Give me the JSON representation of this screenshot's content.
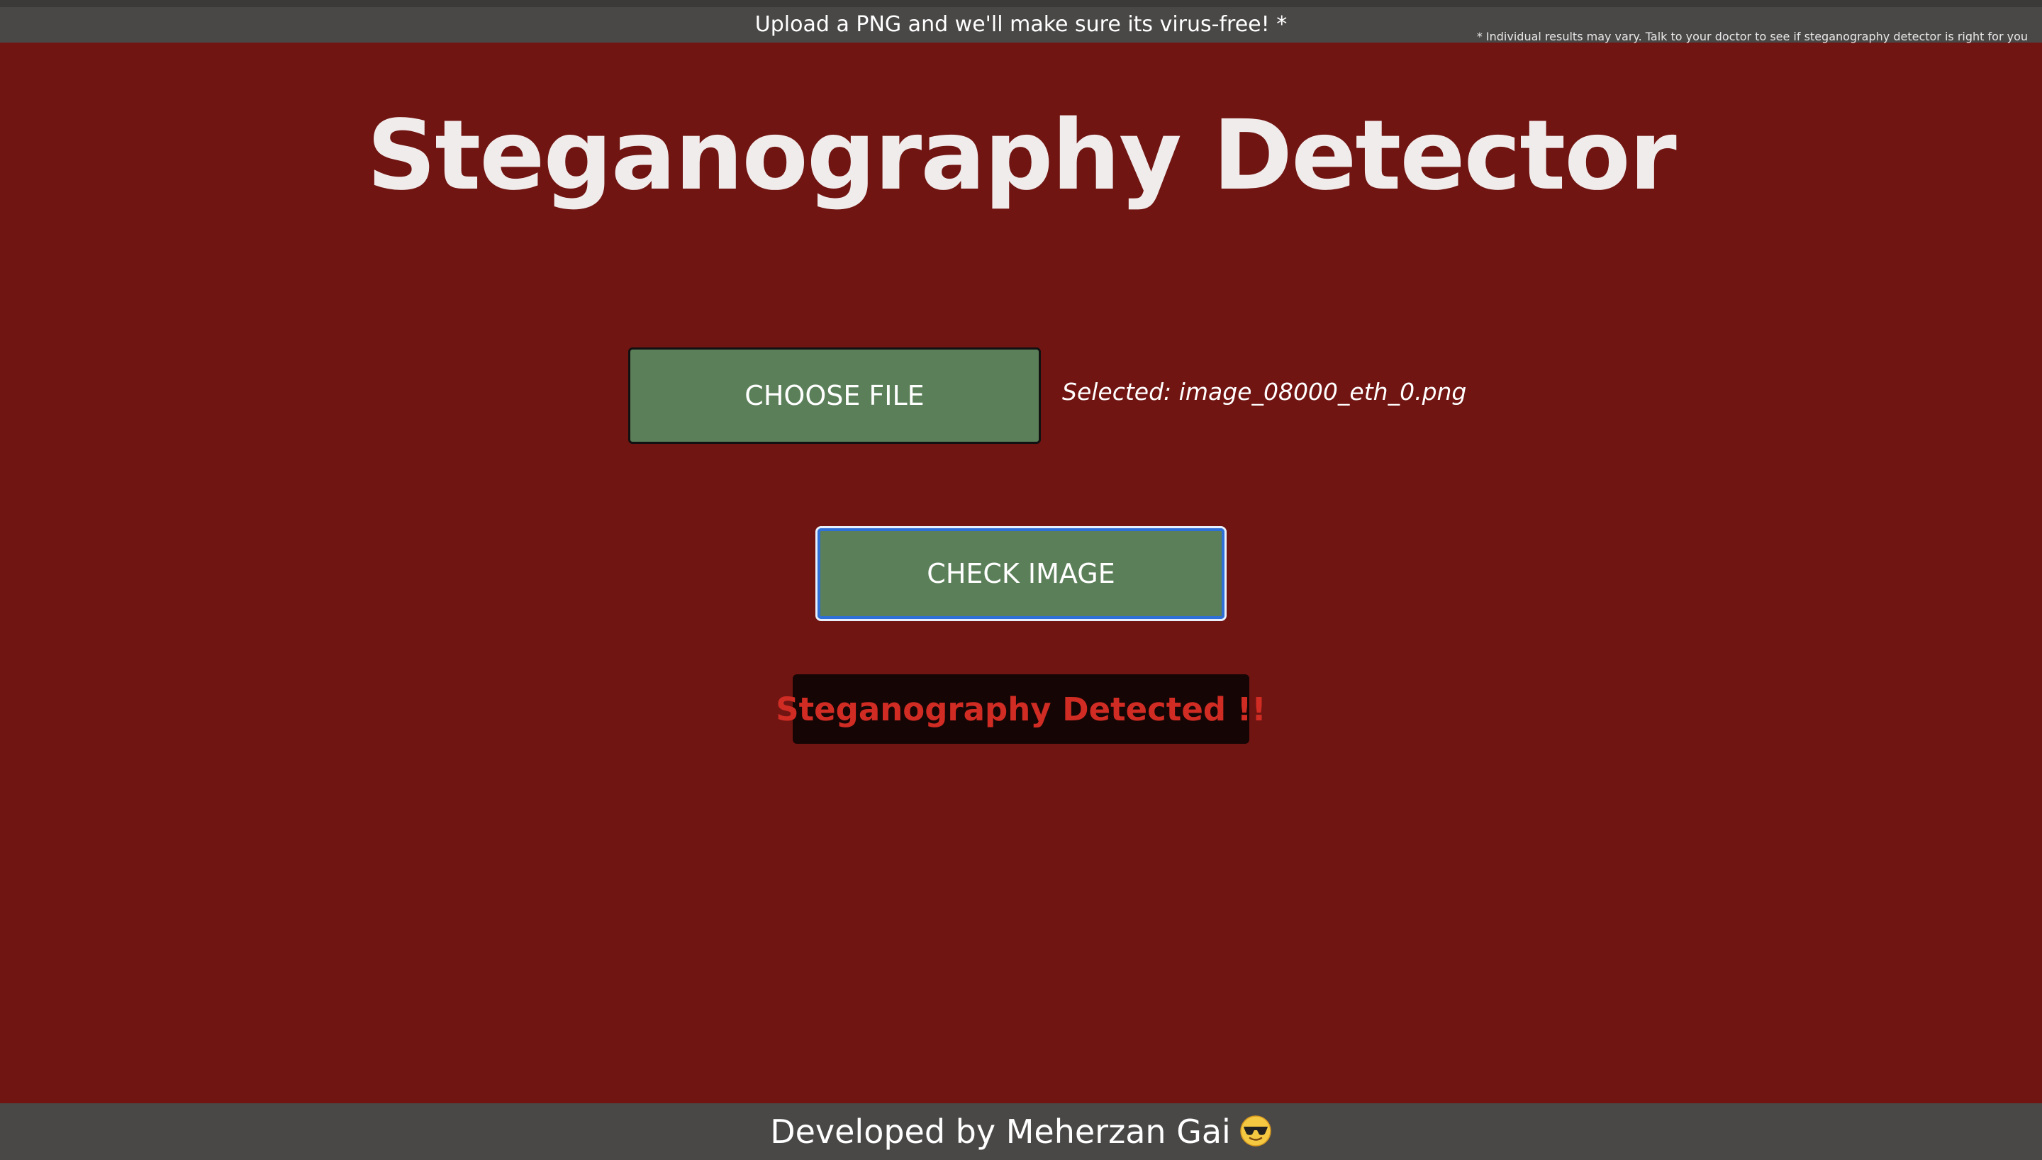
{
  "header": {
    "tagline": "Upload a PNG and we'll make sure its virus-free! *",
    "disclaimer": "* Individual results may vary. Talk to your doctor to see if steganography detector is right for you"
  },
  "main": {
    "title": "Steganography Detector",
    "choose_file_label": "CHOOSE FILE",
    "selected_text": "Selected: image_08000_eth_0.png",
    "check_image_label": "CHECK IMAGE",
    "result_text": "Steganography Detected !!"
  },
  "footer": {
    "text": "Developed by Meherzan Gai",
    "icon": "sunglasses-emoji-icon"
  },
  "colors": {
    "background": "#711512",
    "bar": "#4a4847",
    "button": "#5b7f59",
    "result_bg": "#150605",
    "result_text": "#d12c24",
    "focus_ring": "#2f6fd8"
  }
}
